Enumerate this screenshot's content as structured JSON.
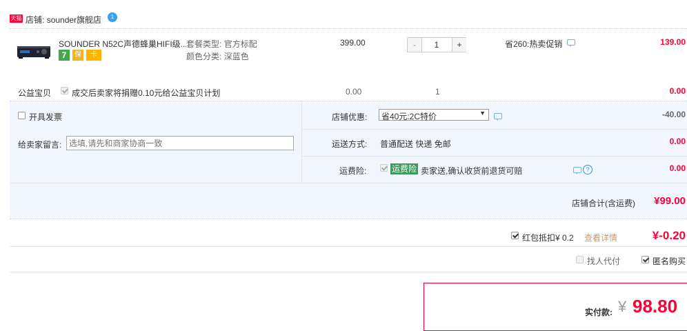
{
  "shop": {
    "tmall_badge": "天猫",
    "label_prefix": "店铺:",
    "name": "sounder旗舰店",
    "chat_badge": "1"
  },
  "item": {
    "title": "SOUNDER N52C声德蜂巢HIFI级...",
    "spec_type_label": "套餐类型:",
    "spec_type_value": "官方标配",
    "color_label": "颜色分类:",
    "color_value": "深蓝色",
    "badges": [
      "7",
      "保",
      "卡"
    ],
    "unit_price": "399.00",
    "quantity": "1",
    "minus": "-",
    "plus": "+",
    "promo": "省260:热卖促销",
    "subtotal": "139.00"
  },
  "charity": {
    "label": "公益宝贝",
    "text": "成交后卖家将捐赠0.10元给公益宝贝计划",
    "price": "0.00",
    "qty": "1",
    "subtotal": "0.00"
  },
  "invoice": {
    "label": "开具发票"
  },
  "shop_discount": {
    "label": "店铺优惠:",
    "selected": "省40元:2C特价",
    "amount": "-40.00"
  },
  "message": {
    "label": "给卖家留言:",
    "placeholder": "选填,请先和商家协商一致"
  },
  "delivery": {
    "label": "运送方式:",
    "value": "普通配送 快递 免邮",
    "amount": "0.00"
  },
  "insurance": {
    "label": "运费险:",
    "badge": "运费险",
    "text": "卖家送,确认收货前退货可赔",
    "amount": "0.00"
  },
  "shop_total": {
    "label": "店铺合计(含运费)",
    "value": "¥99.00"
  },
  "redpacket": {
    "text": "红包抵扣¥ 0.2",
    "link": "查看详情",
    "amount": "¥-0.20"
  },
  "options": {
    "proxy_pay": "找人代付",
    "anonymous": "匿名购买"
  },
  "payment": {
    "label": "实付款:",
    "currency": "¥",
    "value": "98.80"
  },
  "colors": {
    "accent_red": "#ff0036",
    "light_blue_bg": "#f2f7ff",
    "dotted_blue": "#b2d1ff",
    "insurance_green": "#3d9a5b"
  }
}
